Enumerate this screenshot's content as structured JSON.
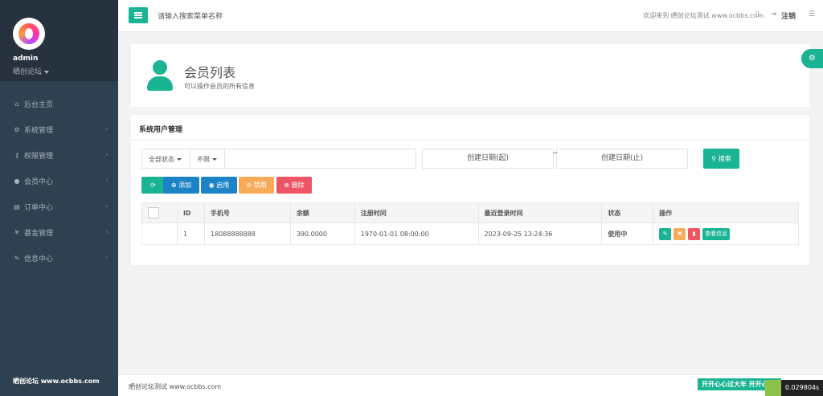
{
  "sidebar": {
    "username": "admin",
    "role": "晒创论坛",
    "items": [
      {
        "label": "后台主页",
        "icon": "home-icon",
        "glyph": "⌂",
        "has_arrow": false
      },
      {
        "label": "系统管理",
        "icon": "gears-icon",
        "glyph": "⚙",
        "has_arrow": true
      },
      {
        "label": "权限管理",
        "icon": "key-icon",
        "glyph": "⚷",
        "has_arrow": true
      },
      {
        "label": "会员中心",
        "icon": "user-icon",
        "glyph": "●",
        "has_arrow": true
      },
      {
        "label": "订单中心",
        "icon": "list-icon",
        "glyph": "▤",
        "has_arrow": true
      },
      {
        "label": "基金管理",
        "icon": "yen-icon",
        "glyph": "¥",
        "has_arrow": true
      },
      {
        "label": "信息中心",
        "icon": "wrench-icon",
        "glyph": "✎",
        "has_arrow": true
      }
    ],
    "footer": "晒创论坛 www.ocbbs.com"
  },
  "topbar": {
    "search_placeholder": "请输入搜索菜单名称",
    "welcome": "欢迎来到 晒创论坛测试 www.ocbbs.com",
    "logout": "注销"
  },
  "header": {
    "title": "会员列表",
    "subtitle": "可以操作会员的所有信息"
  },
  "panel": {
    "title": "系统用户管理",
    "filter_status": "全部状态",
    "filter_limit": "不限",
    "date_start": "创建日期(起)",
    "date_end": "创建日期(止)",
    "date_sep": "~",
    "search_btn": "搜索",
    "actions": [
      {
        "label": "",
        "icon": "refresh-icon",
        "color": "#1ab394"
      },
      {
        "label": "添加",
        "icon": "plus-icon",
        "color": "#1c84c6"
      },
      {
        "label": "启用",
        "icon": "check-icon",
        "color": "#1c84c6"
      },
      {
        "label": "禁用",
        "icon": "ban-icon",
        "color": "#f8ac59"
      },
      {
        "label": "删除",
        "icon": "remove-icon",
        "color": "#ed5565"
      }
    ]
  },
  "table": {
    "columns": [
      "",
      "ID",
      "手机号",
      "余额",
      "注册时间",
      "最近登录时间",
      "状态",
      "操作"
    ],
    "rows": [
      {
        "id": "1",
        "phone": "18088888888",
        "balance": "390.0000",
        "registered": "1970-01-01 08:00:00",
        "last_login": "2023-09-25 13:24:36",
        "status": "使用中",
        "view_label": "查看信息"
      }
    ]
  },
  "footer": {
    "text": "晒创论坛测试 www.ocbbs.com",
    "ad": "开开心心过大年 开开心心",
    "timer": "0.029804s"
  },
  "colors": {
    "primary": "#1ab394",
    "info": "#1c84c6",
    "warning": "#f8ac59",
    "danger": "#ed5565",
    "sidebar": "#2f4050"
  }
}
